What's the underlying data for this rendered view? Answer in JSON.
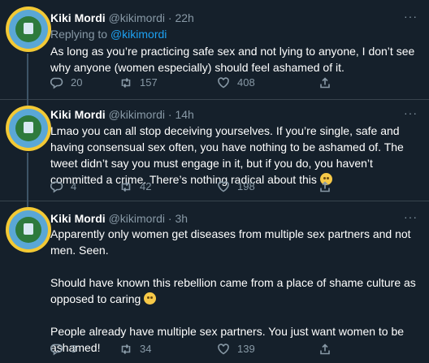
{
  "tweets": [
    {
      "name": "Kiki Mordi",
      "handle": "@kikimordi",
      "dot": "·",
      "time": "22h",
      "replying_prefix": "Replying to ",
      "replying_handle": "@kikimordi",
      "paragraphs": [
        "As long as you’re practicing safe sex and not lying to anyone, I don’t see why anyone (women especially) should feel ashamed of it."
      ],
      "replies": "20",
      "retweets": "157",
      "likes": "408"
    },
    {
      "name": "Kiki Mordi",
      "handle": "@kikimordi",
      "dot": "·",
      "time": "14h",
      "paragraphs": [
        "Lmao you can all stop deceiving yourselves. If you’re single, safe and having consensual sex often, you have nothing to be ashamed of. The tweet didn’t say you must engage in it, but if you do, you haven’t committed a crime. There’s nothing radical about this"
      ],
      "replies": "4",
      "retweets": "42",
      "likes": "198"
    },
    {
      "name": "Kiki Mordi",
      "handle": "@kikimordi",
      "dot": "·",
      "time": "3h",
      "paragraphs": [
        "Apparently only women get diseases from multiple sex partners and not men. Seen.",
        "Should have known this rebellion came from a place of shame culture as opposed to caring",
        "People already have multiple sex partners. You just want women to be ashamed!"
      ],
      "replies": "3",
      "retweets": "34",
      "likes": "139"
    }
  ],
  "more_label": "···",
  "icons": [
    "reply-icon",
    "retweet-icon",
    "like-icon",
    "share-icon",
    "more-icon",
    "emoji-icon"
  ],
  "colors": {
    "background": "#15202b",
    "muted": "#8899a6",
    "accent": "#1da1f2",
    "divider": "#38444d"
  }
}
